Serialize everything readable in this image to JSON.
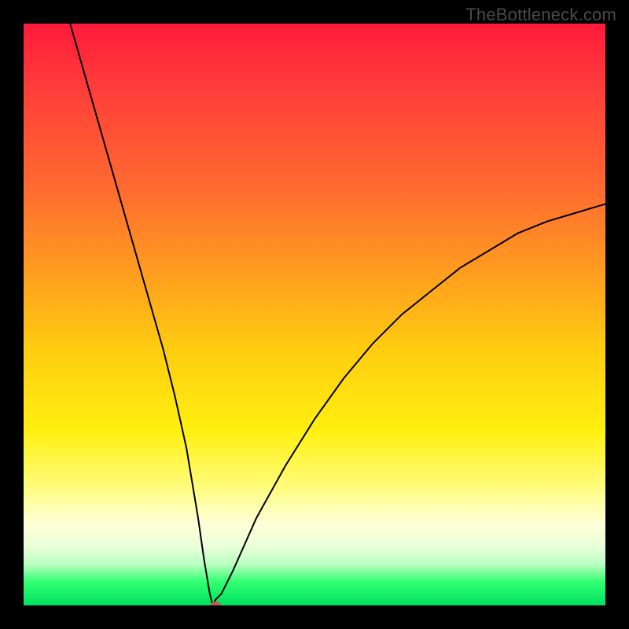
{
  "watermark": "TheBottleneck.com",
  "chart_data": {
    "type": "line",
    "title": "",
    "xlabel": "",
    "ylabel": "",
    "xlim": [
      0,
      100
    ],
    "ylim": [
      0,
      100
    ],
    "grid": false,
    "legend": false,
    "background": "vertical-gradient-red-to-green",
    "series": [
      {
        "name": "bottleneck-curve",
        "x": [
          8,
          10,
          12,
          14,
          16,
          18,
          20,
          22,
          24,
          26,
          28,
          30,
          31,
          32,
          32.5,
          33,
          34,
          36,
          40,
          45,
          50,
          55,
          60,
          65,
          70,
          75,
          80,
          85,
          90,
          95,
          100
        ],
        "y": [
          100,
          93,
          86,
          79,
          72,
          65,
          58,
          51,
          44,
          36,
          27,
          15,
          8,
          2,
          0,
          1,
          2,
          6,
          15,
          24,
          32,
          39,
          45,
          50,
          54,
          58,
          61,
          64,
          66,
          67.5,
          69
        ]
      }
    ],
    "marker": {
      "name": "optimum-point",
      "x": 33,
      "y": 0,
      "color": "#c05a4a"
    }
  }
}
